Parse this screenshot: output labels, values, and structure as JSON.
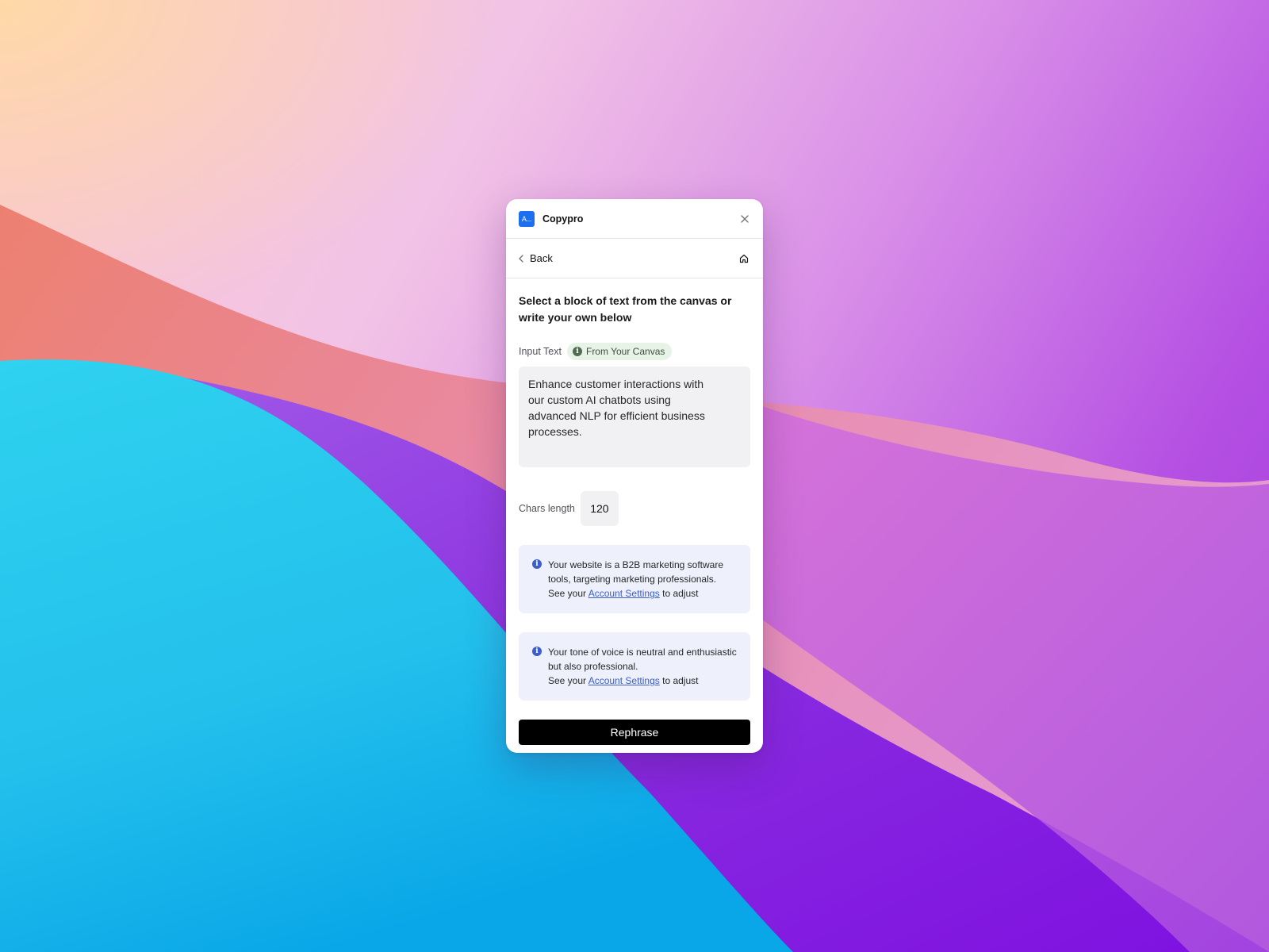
{
  "app": {
    "logo_text": "A...",
    "title": "Copypro"
  },
  "nav": {
    "back_label": "Back"
  },
  "main": {
    "heading": "Select a block of text from the canvas or write your own below",
    "input_label": "Input Text",
    "source_badge": "From Your Canvas",
    "input_value": "Enhance customer interactions with our custom AI chatbots using advanced NLP for efficient business processes.",
    "chars_label": "Chars length",
    "chars_value": "120"
  },
  "info_boxes": [
    {
      "text": "Your website is a B2B marketing software tools, targeting marketing professionals.",
      "see_prefix": "See your",
      "link_label": "Account Settings",
      "suffix": "to adjust"
    },
    {
      "text": "Your tone of voice is neutral and enthusiastic but also professional.",
      "see_prefix": "See your",
      "link_label": "Account Settings",
      "suffix": "to adjust"
    }
  ],
  "actions": {
    "rephrase_label": "Rephrase"
  },
  "icons": {
    "close": "close-icon",
    "back": "chevron-left-icon",
    "home": "home-icon",
    "info": "info-icon"
  },
  "colors": {
    "logo_blue": "#1b6ff0",
    "badge_bg": "#e6f3e6",
    "info_bg": "#eef1fb",
    "link_blue": "#3d5ec9",
    "button_black": "#000000"
  }
}
